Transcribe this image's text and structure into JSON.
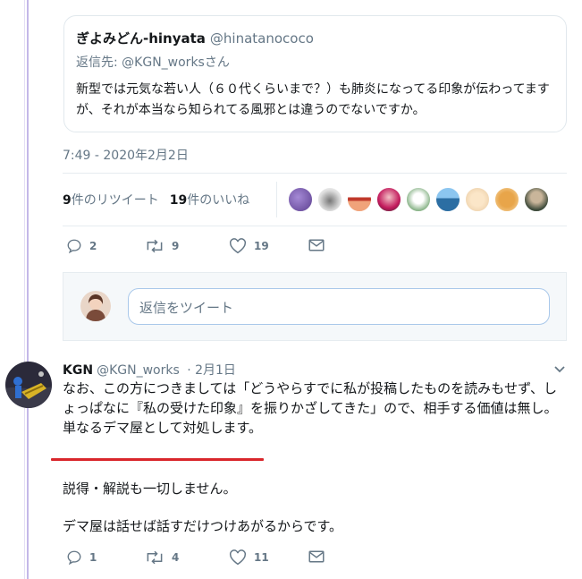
{
  "quoted_tweet": {
    "display_name": "ぎよみどん-hinyata",
    "handle": "@hinatanococo",
    "reply_to": "返信先: @KGN_worksさん",
    "text": "新型では元気な若い人（６０代くらいまで？）も肺炎になってる印象が伝わってますが、それが本当なら知られてる風邪とは違うのでないですか。"
  },
  "timestamp": "7:49 - 2020年2月2日",
  "stats": {
    "retweet_count": "9",
    "retweet_label": "件のリツイート",
    "like_count": "19",
    "like_label": "件のいいね"
  },
  "main_actions": {
    "reply_count": "2",
    "retweet_count": "9",
    "like_count": "19"
  },
  "reply_box": {
    "placeholder": "返信をツイート"
  },
  "reply_tweet": {
    "display_name": "KGN",
    "handle": "@KGN_works",
    "date": "· 2月1日",
    "text_lines": [
      "なお、この方につきましては「どうやらすでに私が投稿したものを読みもせず、しょっぱなに『私の受けた印象』を振りかざしてきた」ので、相手する価値は無し。",
      "単なるデマ屋として対処します。"
    ],
    "para2": "説得・解説も一切しません。",
    "para3": "デマ屋は話せば話すだけつけあがるからです。",
    "reply_count": "1",
    "retweet_count": "4",
    "like_count": "11"
  },
  "colors": {
    "accent": "#1da1f2",
    "muted": "#657786",
    "thread_line": "#c4b8e8",
    "annotation_underline": "#d9262b"
  }
}
